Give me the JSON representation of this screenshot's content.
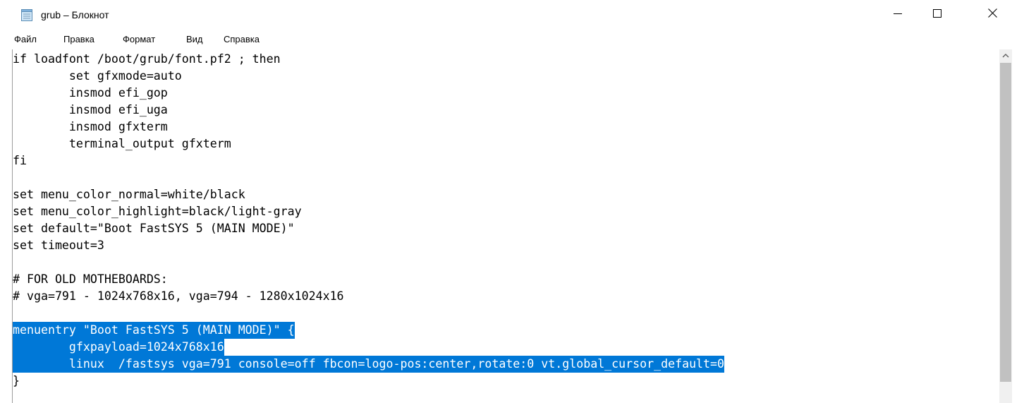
{
  "window": {
    "title": "grub – Блокнот",
    "icon": "notepad-icon",
    "controls": [
      "minimize-icon",
      "maximize-icon",
      "close-icon"
    ]
  },
  "menu": {
    "items": [
      "Файл",
      "Правка",
      "Формат",
      "Вид",
      "Справка"
    ]
  },
  "editor": {
    "selection_color": "#0078d7",
    "lines": [
      "if loadfont /boot/grub/font.pf2 ; then",
      "        set gfxmode=auto",
      "        insmod efi_gop",
      "        insmod efi_uga",
      "        insmod gfxterm",
      "        terminal_output gfxterm",
      "fi",
      "",
      "set menu_color_normal=white/black",
      "set menu_color_highlight=black/light-gray",
      "set default=\"Boot FastSYS 5 (MAIN MODE)\"",
      "set timeout=3",
      "",
      "# FOR OLD MOTHEBOARDS:",
      "# vga=791 - 1024x768x16, vga=794 - 1280x1024x16",
      "",
      "menuentry \"Boot FastSYS 5 (MAIN MODE)\" {",
      "        gfxpayload=1024x768x16",
      "        linux  /fastsys vga=791 console=off fbcon=logo-pos:center,rotate:0 vt.global_cursor_default=0",
      "}"
    ]
  },
  "scrollbar": {
    "up_icon": "chevron-up-icon"
  }
}
